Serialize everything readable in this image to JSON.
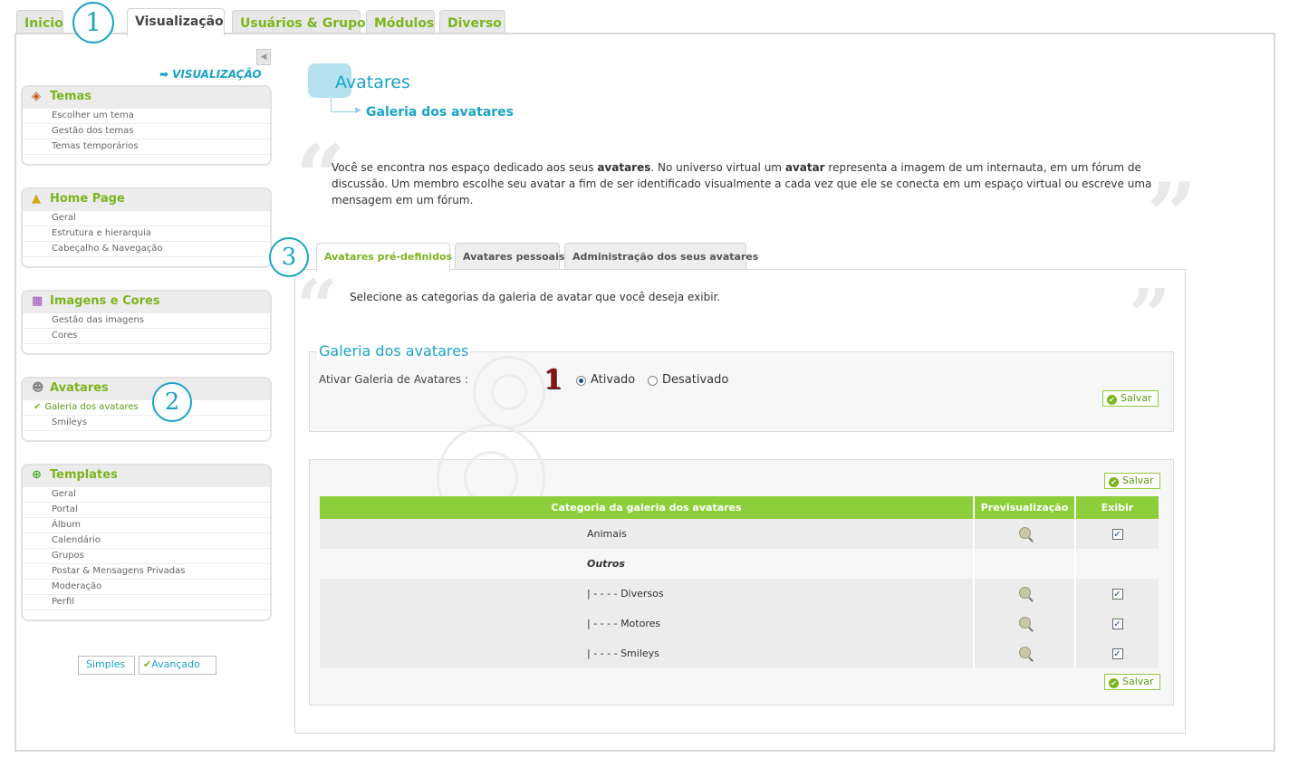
{
  "top_tabs": [
    "Inicio",
    "Visualização",
    "Usuários & Grupos",
    "Módulos",
    "Diverso"
  ],
  "badges": {
    "step1": "1",
    "step2": "2",
    "step3": "3",
    "marker": "1"
  },
  "sidebar": {
    "collapse_glyph": "◀",
    "section_title": "VISUALIZAÇÃO",
    "section_arrow": "➡",
    "panels": [
      {
        "title": "Temas",
        "icon": "themes-icon",
        "items": [
          "Escolher um tema",
          "Gestão dos temas",
          "Temas temporários"
        ]
      },
      {
        "title": "Home Page",
        "icon": "home-page-icon",
        "items": [
          "Geral",
          "Estrutura e hierarquia",
          "Cabeçalho & Navegação"
        ]
      },
      {
        "title": "Imagens e Cores",
        "icon": "images-colors-icon",
        "items": [
          "Gestão das imagens",
          "Cores"
        ]
      },
      {
        "title": "Avatares",
        "icon": "avatar-icon",
        "items": [
          "Galeria dos avatares",
          "Smileys"
        ],
        "active_item": "Galeria dos avatares"
      },
      {
        "title": "Templates",
        "icon": "templates-icon",
        "items": [
          "Geral",
          "Portal",
          "Álbum",
          "Calendário",
          "Grupos",
          "Postar & Mensagens Privadas",
          "Moderação",
          "Perfil"
        ]
      }
    ],
    "mode_buttons": {
      "simple": "Simples",
      "advanced": "Avançado"
    }
  },
  "main": {
    "title": "Avatares",
    "subtitle": "Galeria dos avatares",
    "intro_parts": {
      "p1": "Você se encontra nos espaço dedicado aos seus ",
      "b1": "avatares",
      "p2": ". No universo virtual um ",
      "b2": "avatar",
      "p3": " representa a imagem de um internauta, em um fórum de discussão. Um membro escolhe seu avatar a fim de ser identificado visualmente a cada vez que ele se conecta em um espaço virtual ou escreve uma mensagem em um fórum."
    },
    "tabs": [
      "Avatares pré-definidos",
      "Avatares pessoais",
      "Administração dos seus avatares"
    ],
    "tab_description": "Selecione as categorias da galeria de avatar que você deseja exibir.",
    "gallery_form": {
      "legend": "Galeria dos avatares",
      "label": "Ativar Galeria de Avatares :",
      "options": [
        "Ativado",
        "Desativado"
      ],
      "selected": "Ativado",
      "save_label": "Salvar"
    },
    "table": {
      "headers": [
        "Categoria da galeria dos avatares",
        "Previsualização",
        "Exibir"
      ],
      "rows": [
        {
          "name": "Animais",
          "type": "item",
          "checked": true
        },
        {
          "name": "Outros",
          "type": "group"
        },
        {
          "name": "| - - - - Diversos",
          "type": "item",
          "checked": true
        },
        {
          "name": "| - - - - Motores",
          "type": "item",
          "checked": true
        },
        {
          "name": "| - - - - Smileys",
          "type": "item",
          "checked": true
        }
      ],
      "save_label": "Salvar"
    },
    "quote_open": "“",
    "quote_close": "”"
  },
  "colors": {
    "accent_green": "#7cb51e",
    "accent_blue": "#1aa3c7",
    "header_green": "#8dcf3a"
  }
}
